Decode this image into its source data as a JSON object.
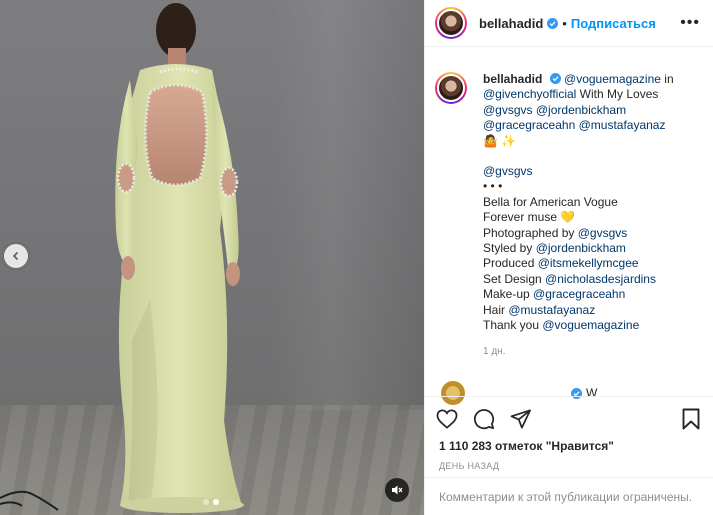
{
  "header": {
    "username": "bellahadid",
    "separator": "•",
    "follow_label": "Подписаться",
    "more_label": "•••"
  },
  "caption": {
    "username": "bellahadid",
    "mention_1": "@voguemagazine",
    "text_in": " in",
    "mention_2": "@givenchyofficial",
    "text_loves": " With My Loves",
    "mention_3": "@gvsgvs",
    "mention_4": "@jordenbickham",
    "mention_5": "@gracegraceahn",
    "mention_6": "@mustafayanaz",
    "emojis": "🤷 ✨",
    "mention_7": "@gvsgvs",
    "dots_line": "• • •",
    "line_bella": "Bella for American Vogue",
    "line_forever": "Forever muse ",
    "heart": "💛",
    "label_photo": "Photographed by ",
    "photo_by": "@gvsgvs",
    "label_styled": "Styled by ",
    "styled_by": "@jordenbickham",
    "label_produced": "Produced ",
    "produced_by": "@itsmekellymcgee",
    "label_set": "Set Design ",
    "set_by": "@nicholasdesjardins",
    "label_makeup": "Make-up ",
    "makeup_by": "@gracegraceahn",
    "label_hair": "Hair ",
    "hair_by": "@mustafayanaz",
    "label_thanks": "Thank you ",
    "thanks_to": "@voguemagazine",
    "time": "1 дн."
  },
  "next_comment_partial": "W",
  "actions": {
    "likes": "1 110 283 отметок \"Нравится\"",
    "date": "день назад",
    "comments_closed": "Комментарии к этой публикации ограничены."
  },
  "media": {
    "carousel_count": 2,
    "carousel_active": 2,
    "prev_icon": "chevron-left-icon",
    "mute_icon": "speaker-muted-icon"
  },
  "colors": {
    "accent": "#0095f6",
    "link": "#00376b",
    "verified": "#3897f0",
    "secondary_text": "#8e8e8e"
  }
}
